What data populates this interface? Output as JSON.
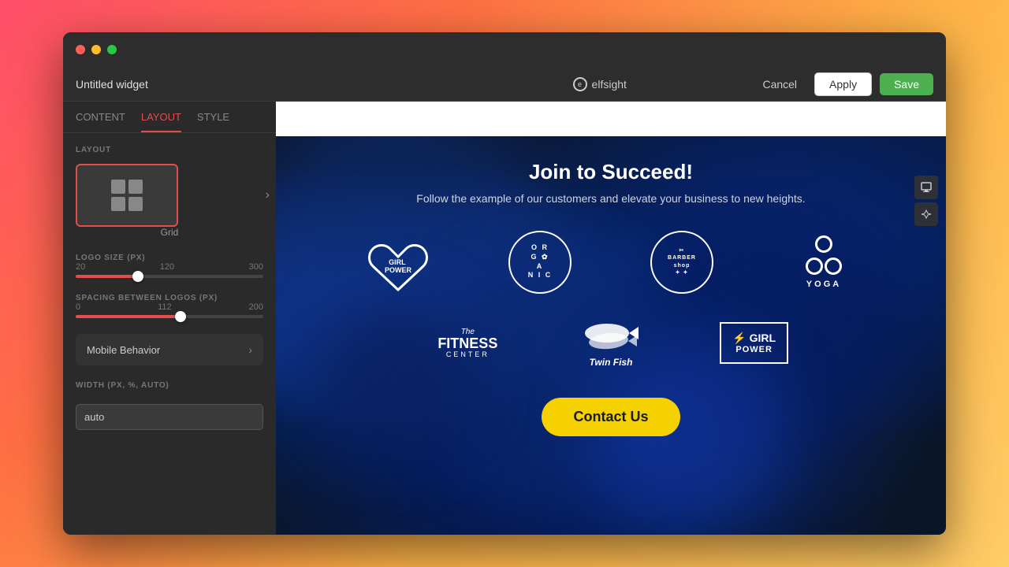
{
  "window": {
    "traffic_lights": [
      "red",
      "yellow",
      "green"
    ],
    "widget_name": "Untitled widget"
  },
  "topbar": {
    "logo_text": "elfsight",
    "cancel_label": "Cancel",
    "apply_label": "Apply",
    "save_label": "Save"
  },
  "sidebar": {
    "tabs": [
      {
        "id": "content",
        "label": "CONTENT"
      },
      {
        "id": "layout",
        "label": "LAYOUT",
        "active": true
      },
      {
        "id": "style",
        "label": "STYLE"
      }
    ],
    "layout_section_label": "LAYOUT",
    "layout_option": {
      "label": "Grid",
      "selected": true
    },
    "logo_size": {
      "label": "LOGO SIZE (PX)",
      "min": 20,
      "max": 300,
      "value": 120,
      "percent": 33
    },
    "spacing": {
      "label": "SPACING BETWEEN LOGOS (PX)",
      "min": 0,
      "max": 200,
      "value": 112,
      "percent": 56
    },
    "mobile_behavior": {
      "label": "Mobile Behavior"
    },
    "width_section": {
      "label": "WIDTH (PX, %, AUTO)",
      "value": "auto"
    }
  },
  "preview": {
    "title": "Join to Succeed!",
    "subtitle": "Follow the example of our customers and elevate your business to new heights.",
    "contact_btn": "Contact Us",
    "logos_row1": [
      {
        "name": "girl-power",
        "type": "heart"
      },
      {
        "name": "organic-cafe",
        "type": "circle-text"
      },
      {
        "name": "barber-shop",
        "type": "barber-circle"
      },
      {
        "name": "yoga",
        "type": "yoga-circles"
      }
    ],
    "logos_row2": [
      {
        "name": "fitness-center",
        "type": "fitness"
      },
      {
        "name": "twin-fish",
        "type": "fish"
      },
      {
        "name": "girl-power-2",
        "type": "girlpower2"
      }
    ]
  }
}
